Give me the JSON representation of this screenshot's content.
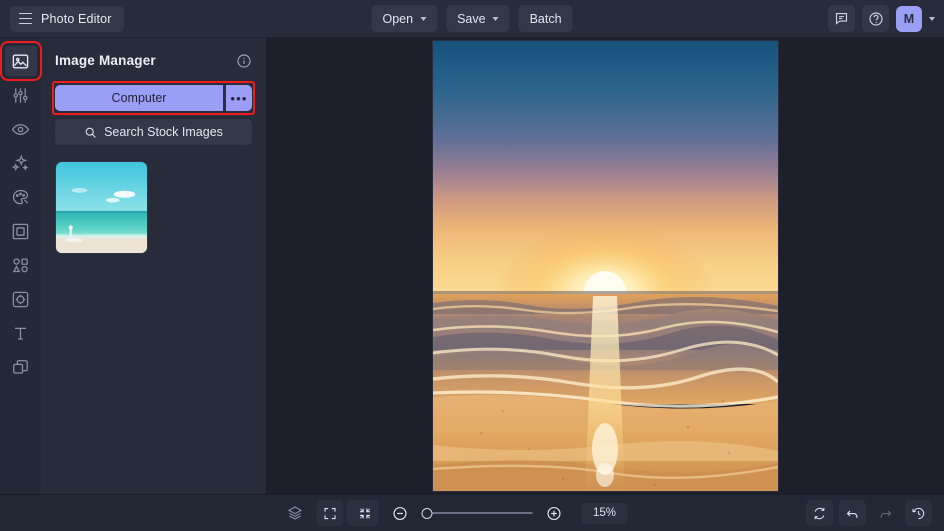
{
  "app": {
    "title": "Photo Editor",
    "menu_icon": "hamburger-icon"
  },
  "header": {
    "tools": [
      {
        "label": "Open",
        "has_caret": true
      },
      {
        "label": "Save",
        "has_caret": true
      },
      {
        "label": "Batch",
        "has_caret": false
      }
    ],
    "right_icons": [
      "chat-icon",
      "help-icon"
    ],
    "avatar_initial": "M"
  },
  "rail": {
    "items": [
      {
        "name": "image-manager",
        "icon": "image-icon",
        "active": true,
        "highlighted": true
      },
      {
        "name": "adjust",
        "icon": "sliders-icon",
        "active": false,
        "highlighted": false
      },
      {
        "name": "retouch",
        "icon": "eye-icon",
        "active": false,
        "highlighted": false
      },
      {
        "name": "effects",
        "icon": "sparkles-icon",
        "active": false,
        "highlighted": false
      },
      {
        "name": "paint",
        "icon": "palette-icon",
        "active": false,
        "highlighted": false
      },
      {
        "name": "frames",
        "icon": "frame-icon",
        "active": false,
        "highlighted": false
      },
      {
        "name": "shapes",
        "icon": "shapes-icon",
        "active": false,
        "highlighted": false
      },
      {
        "name": "stickers",
        "icon": "sticker-icon",
        "active": false,
        "highlighted": false
      },
      {
        "name": "text",
        "icon": "text-icon",
        "active": false,
        "highlighted": false
      },
      {
        "name": "layers",
        "icon": "layers-overlap-icon",
        "active": false,
        "highlighted": false
      }
    ]
  },
  "panel": {
    "title": "Image Manager",
    "info_icon": "info-icon",
    "source_button": {
      "label": "Computer",
      "more_label": "•••",
      "highlighted": true
    },
    "search_button": {
      "label": "Search Stock Images",
      "icon": "search-icon"
    },
    "thumbnails": [
      {
        "name": "beach-thumbnail",
        "alt": "Tropical beach with turquoise water"
      }
    ]
  },
  "canvas": {
    "image_name": "sunset-beach-photo",
    "alt": "Ocean sunset with waves and reflection on wet sand"
  },
  "bottombar": {
    "left_icons": [
      {
        "name": "layers-stack-icon",
        "filled": false
      },
      {
        "name": "transform-icon",
        "filled": false
      },
      {
        "name": "grid-icon",
        "filled": true
      }
    ],
    "center_icons": [
      {
        "name": "fullscreen-icon",
        "filled": true
      },
      {
        "name": "fit-to-screen-icon",
        "filled": true
      }
    ],
    "zoom_out_icon": "zoom-out-icon",
    "zoom_in_icon": "zoom-in-icon",
    "zoom_level": "15%",
    "right_icons": [
      {
        "name": "reset-rotate-icon",
        "filled": true,
        "dim": false
      },
      {
        "name": "undo-icon",
        "filled": true,
        "dim": false
      },
      {
        "name": "redo-icon",
        "filled": false,
        "dim": true
      },
      {
        "name": "history-icon",
        "filled": true,
        "dim": false
      }
    ]
  },
  "colors": {
    "accent": "#9a9ef5",
    "highlight": "#f21b1b",
    "header_bg": "#272b3a",
    "canvas_bg": "#1d1f2b",
    "rail_bg": "#252836"
  }
}
